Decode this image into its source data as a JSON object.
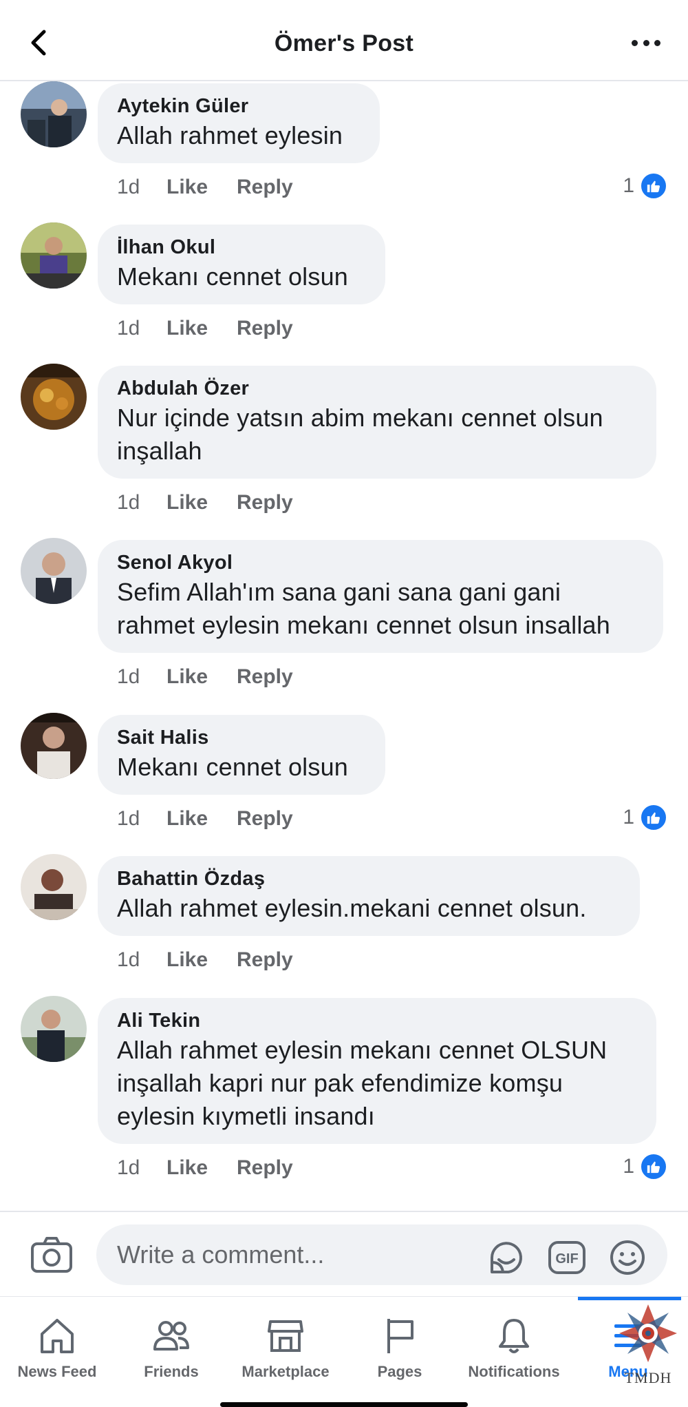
{
  "header": {
    "title": "Ömer's Post"
  },
  "comments": [
    {
      "author": "Aytekin Güler",
      "text": "Allah rahmet eylesin",
      "age": "1d",
      "like_label": "Like",
      "reply_label": "Reply",
      "reactions": "1"
    },
    {
      "author": "İlhan Okul",
      "text": "Mekanı cennet olsun",
      "age": "1d",
      "like_label": "Like",
      "reply_label": "Reply",
      "reactions": ""
    },
    {
      "author": "Abdulah Özer",
      "text": "Nur içinde yatsın abim mekanı cennet olsun inşallah",
      "age": "1d",
      "like_label": "Like",
      "reply_label": "Reply",
      "reactions": ""
    },
    {
      "author": "Senol Akyol",
      "text": "Sefim Allah'ım sana gani sana gani gani rahmet eylesin mekanı cennet olsun insallah",
      "age": "1d",
      "like_label": "Like",
      "reply_label": "Reply",
      "reactions": ""
    },
    {
      "author": "Sait Halis",
      "text": "Mekanı cennet olsun",
      "age": "1d",
      "like_label": "Like",
      "reply_label": "Reply",
      "reactions": "1"
    },
    {
      "author": "Bahattin Özdaş",
      "text": "Allah rahmet eylesin.mekani cennet olsun.",
      "age": "1d",
      "like_label": "Like",
      "reply_label": "Reply",
      "reactions": ""
    },
    {
      "author": "Ali Tekin",
      "text": "Allah rahmet eylesin mekanı cennet OLSUN inşallah kapri nur pak efendimize komşu eylesin kıymetli insandı",
      "age": "1d",
      "like_label": "Like",
      "reply_label": "Reply",
      "reactions": "1"
    }
  ],
  "composer": {
    "placeholder": "Write a comment..."
  },
  "composer_icons": [
    "camera-icon",
    "sticker-icon",
    "gif-icon",
    "emoji-icon"
  ],
  "bottom_nav": [
    {
      "label": "News Feed",
      "icon": "home-icon"
    },
    {
      "label": "Friends",
      "icon": "friends-icon"
    },
    {
      "label": "Marketplace",
      "icon": "marketplace-icon"
    },
    {
      "label": "Pages",
      "icon": "flag-icon"
    },
    {
      "label": "Notifications",
      "icon": "bell-icon"
    },
    {
      "label": "Menu",
      "icon": "menu-icon",
      "active": true
    }
  ],
  "watermark": {
    "text": "TMDH"
  },
  "colors": {
    "accent": "#1877f2",
    "bubble": "#f0f2f5",
    "secondary_text": "#65676b"
  }
}
